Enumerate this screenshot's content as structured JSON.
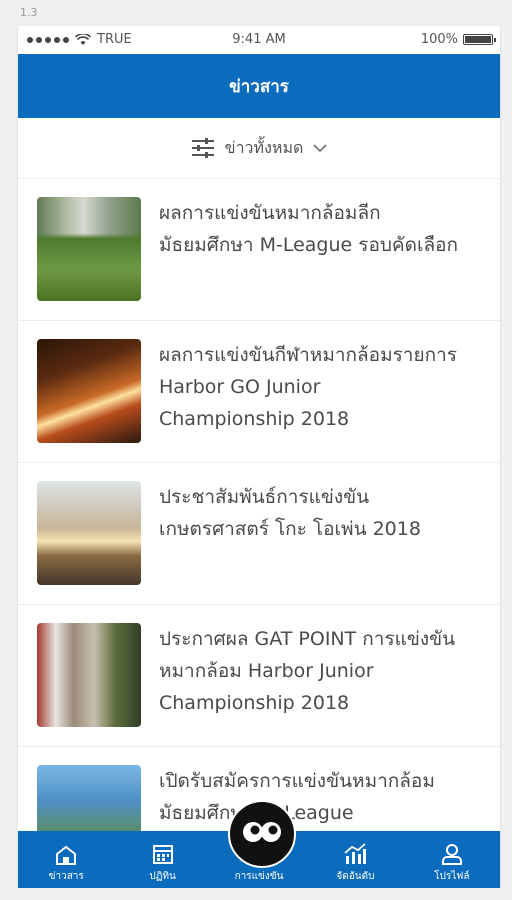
{
  "version": "1.3",
  "status_bar": {
    "carrier": "TRUE",
    "time": "9:41 AM",
    "battery_text": "100%",
    "battery_level": 1.0
  },
  "header": {
    "title": "ข่าวสาร"
  },
  "filter": {
    "label": "ข่าวทั้งหมด"
  },
  "news": [
    {
      "title": "ผลการแข่งขันหมากล้อมลีกมัธยมศึกษา M-League รอบคัดเลือก"
    },
    {
      "title": "ผลการแข่งขันกีฬาหมากล้อมรายการ Harbor GO Junior Championship 2018"
    },
    {
      "title": "ประชาสัมพันธ์การแข่งขันเกษตรศาสตร์ โกะ โอเพ่น 2018"
    },
    {
      "title": "ประกาศผล GAT POINT การแข่งขันหมากล้อม Harbor Junior Championship 2018"
    },
    {
      "title": "เปิดรับสมัครการแข่งขันหมากล้อมมัธยมศึกษา(M-League"
    }
  ],
  "tabs": [
    {
      "label": "ข่าวสาร",
      "icon": "home-icon"
    },
    {
      "label": "ปฏิทิน",
      "icon": "calendar-icon"
    },
    {
      "label": "การแข่งขัน",
      "icon": "go-logo-icon"
    },
    {
      "label": "จัดอันดับ",
      "icon": "ranking-chart-icon"
    },
    {
      "label": "โปรไฟล์",
      "icon": "profile-icon"
    }
  ],
  "colors": {
    "primary": "#0b6bbd",
    "text": "#4a4a4a"
  }
}
